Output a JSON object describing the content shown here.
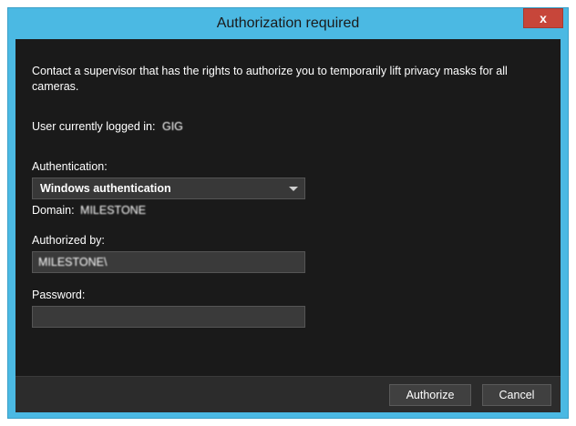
{
  "window": {
    "title": "Authorization required",
    "close_label": "x"
  },
  "dialog": {
    "message": "Contact a supervisor that has the rights to authorize you to temporarily lift privacy masks for all cameras.",
    "user_label": "User currently logged in:",
    "user_value": "GIG",
    "authentication_label": "Authentication:",
    "authentication_selected": "Windows authentication",
    "domain_label": "Domain:",
    "domain_value": "MILESTONE",
    "authorized_by_label": "Authorized by:",
    "authorized_by_value": "MILESTONE\\",
    "password_label": "Password:",
    "password_value": ""
  },
  "buttons": {
    "authorize": "Authorize",
    "cancel": "Cancel"
  },
  "colors": {
    "window_frame": "#4bb9e3",
    "client_background": "#1a1a1a",
    "close_button": "#c7463a"
  }
}
